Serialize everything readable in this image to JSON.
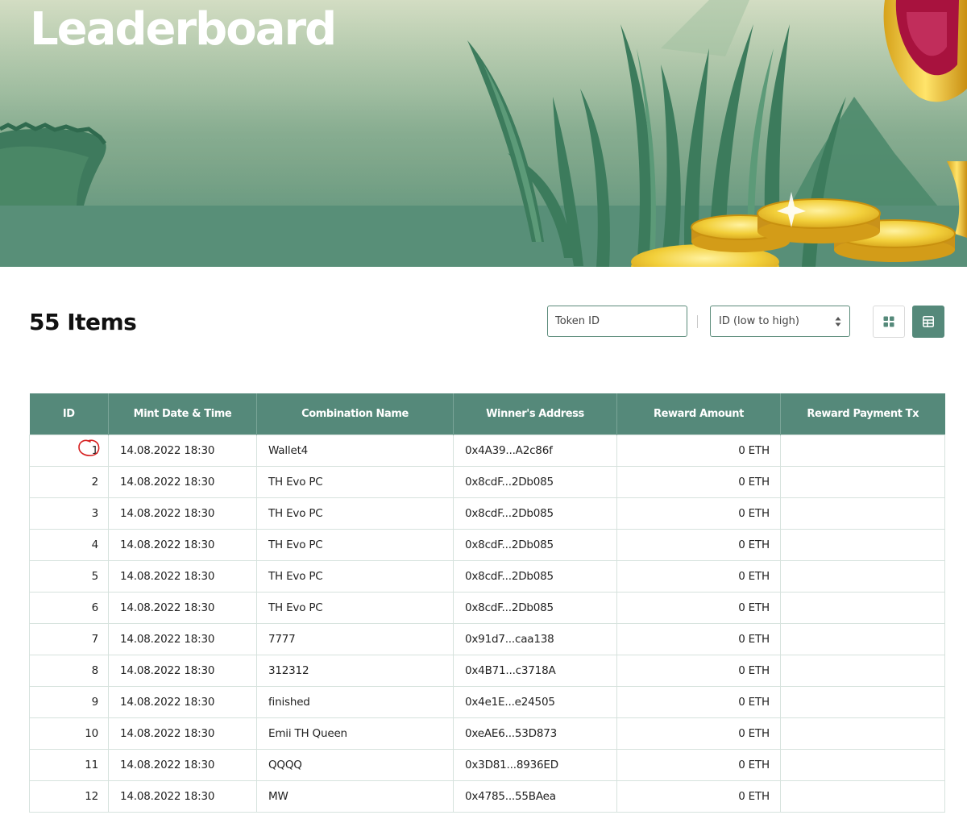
{
  "page": {
    "title": "Leaderboard",
    "items_count": "55 Items"
  },
  "toolbar": {
    "search_placeholder": "Token ID",
    "sort_selected": "ID (low to high)",
    "grid_view_icon": "grid-icon",
    "table_view_icon": "table-view-icon"
  },
  "colors": {
    "accent": "#55897a",
    "annotation": "#d62020"
  },
  "table": {
    "headers": [
      "ID",
      "Mint Date & Time",
      "Combination Name",
      "Winner's Address",
      "Reward Amount",
      "Reward Payment Tx"
    ],
    "rows": [
      {
        "id": "1",
        "date": "14.08.2022 18:30",
        "name": "Wallet4",
        "address": "0x4A39...A2c86f",
        "amount": "0 ETH",
        "tx": ""
      },
      {
        "id": "2",
        "date": "14.08.2022 18:30",
        "name": "TH Evo PC",
        "address": "0x8cdF...2Db085",
        "amount": "0 ETH",
        "tx": ""
      },
      {
        "id": "3",
        "date": "14.08.2022 18:30",
        "name": "TH Evo PC",
        "address": "0x8cdF...2Db085",
        "amount": "0 ETH",
        "tx": ""
      },
      {
        "id": "4",
        "date": "14.08.2022 18:30",
        "name": "TH Evo PC",
        "address": "0x8cdF...2Db085",
        "amount": "0 ETH",
        "tx": ""
      },
      {
        "id": "5",
        "date": "14.08.2022 18:30",
        "name": "TH Evo PC",
        "address": "0x8cdF...2Db085",
        "amount": "0 ETH",
        "tx": ""
      },
      {
        "id": "6",
        "date": "14.08.2022 18:30",
        "name": "TH Evo PC",
        "address": "0x8cdF...2Db085",
        "amount": "0 ETH",
        "tx": ""
      },
      {
        "id": "7",
        "date": "14.08.2022 18:30",
        "name": "7777",
        "address": "0x91d7...caa138",
        "amount": "0 ETH",
        "tx": ""
      },
      {
        "id": "8",
        "date": "14.08.2022 18:30",
        "name": "312312",
        "address": "0x4B71...c3718A",
        "amount": "0 ETH",
        "tx": ""
      },
      {
        "id": "9",
        "date": "14.08.2022 18:30",
        "name": "finished",
        "address": "0x4e1E...e24505",
        "amount": "0 ETH",
        "tx": ""
      },
      {
        "id": "10",
        "date": "14.08.2022 18:30",
        "name": "Emii TH Queen",
        "address": "0xeAE6...53D873",
        "amount": "0 ETH",
        "tx": ""
      },
      {
        "id": "11",
        "date": "14.08.2022 18:30",
        "name": "QQQQ",
        "address": "0x3D81...8936ED",
        "amount": "0 ETH",
        "tx": ""
      },
      {
        "id": "12",
        "date": "14.08.2022 18:30",
        "name": "MW",
        "address": "0x4785...55BAea",
        "amount": "0 ETH",
        "tx": ""
      }
    ]
  }
}
